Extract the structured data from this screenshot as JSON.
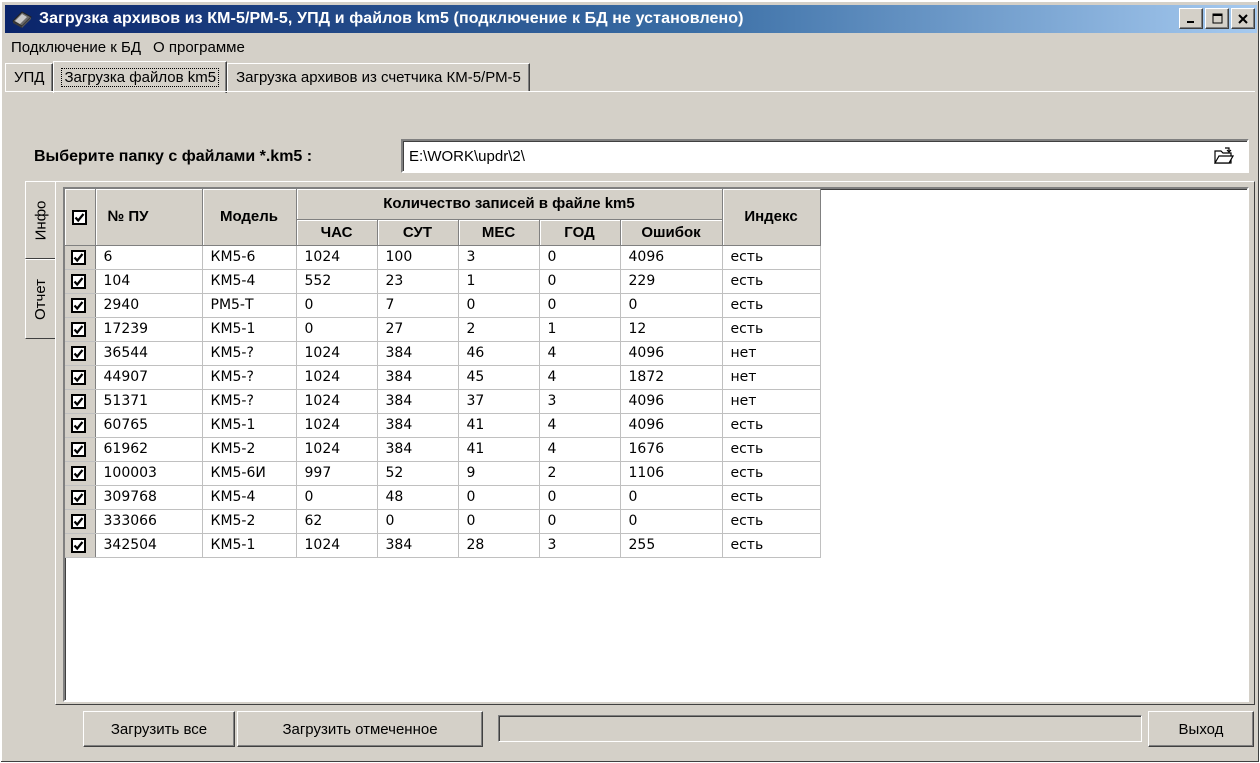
{
  "window": {
    "title": "Загрузка архивов из КМ-5/РМ-5, УПД и файлов km5 (подключение к БД не установлено)",
    "minimize": "_",
    "maximize": "□",
    "close": "×"
  },
  "menu": [
    "Подключение к БД",
    "О программе"
  ],
  "tabs": [
    "УПД",
    "Загрузка файлов km5",
    "Загрузка архивов из счетчика КМ-5/РМ-5"
  ],
  "active_tab": 1,
  "folder": {
    "label": "Выберите папку с файлами *.km5 :",
    "value": "E:\\WORK\\updr\\2\\"
  },
  "side_tabs": [
    "Инфо",
    "Отчет"
  ],
  "grid": {
    "header": {
      "pu": "№ ПУ",
      "model": "Модель",
      "group": "Количество записей в файле km5",
      "hour": "ЧАС",
      "day": "СУТ",
      "month": "МЕС",
      "year": "ГОД",
      "errors": "Ошибок",
      "index": "Индекс"
    },
    "header_checked": true,
    "rows": [
      {
        "checked": true,
        "pu": "6",
        "model": "КМ5-6",
        "hour": "1024",
        "day": "100",
        "month": "3",
        "year": "0",
        "errors": "4096",
        "index": "есть"
      },
      {
        "checked": true,
        "pu": "104",
        "model": "КМ5-4",
        "hour": "552",
        "day": "23",
        "month": "1",
        "year": "0",
        "errors": "229",
        "index": "есть"
      },
      {
        "checked": true,
        "pu": "2940",
        "model": "РМ5-Т",
        "hour": "0",
        "day": "7",
        "month": "0",
        "year": "0",
        "errors": "0",
        "index": "есть"
      },
      {
        "checked": true,
        "pu": "17239",
        "model": "КМ5-1",
        "hour": "0",
        "day": "27",
        "month": "2",
        "year": "1",
        "errors": "12",
        "index": "есть"
      },
      {
        "checked": true,
        "pu": "36544",
        "model": "КМ5-?",
        "hour": "1024",
        "day": "384",
        "month": "46",
        "year": "4",
        "errors": "4096",
        "index": "нет"
      },
      {
        "checked": true,
        "pu": "44907",
        "model": "КМ5-?",
        "hour": "1024",
        "day": "384",
        "month": "45",
        "year": "4",
        "errors": "1872",
        "index": "нет"
      },
      {
        "checked": true,
        "pu": "51371",
        "model": "КМ5-?",
        "hour": "1024",
        "day": "384",
        "month": "37",
        "year": "3",
        "errors": "4096",
        "index": "нет"
      },
      {
        "checked": true,
        "pu": "60765",
        "model": "КМ5-1",
        "hour": "1024",
        "day": "384",
        "month": "41",
        "year": "4",
        "errors": "4096",
        "index": "есть"
      },
      {
        "checked": true,
        "pu": "61962",
        "model": "КМ5-2",
        "hour": "1024",
        "day": "384",
        "month": "41",
        "year": "4",
        "errors": "1676",
        "index": "есть"
      },
      {
        "checked": true,
        "pu": "100003",
        "model": "КМ5-6И",
        "hour": "997",
        "day": "52",
        "month": "9",
        "year": "2",
        "errors": "1106",
        "index": "есть"
      },
      {
        "checked": true,
        "pu": "309768",
        "model": "КМ5-4",
        "hour": "0",
        "day": "48",
        "month": "0",
        "year": "0",
        "errors": "0",
        "index": "есть"
      },
      {
        "checked": true,
        "pu": "333066",
        "model": "КМ5-2",
        "hour": "62",
        "day": "0",
        "month": "0",
        "year": "0",
        "errors": "0",
        "index": "есть"
      },
      {
        "checked": true,
        "pu": "342504",
        "model": "КМ5-1",
        "hour": "1024",
        "day": "384",
        "month": "28",
        "year": "3",
        "errors": "255",
        "index": "есть"
      }
    ]
  },
  "buttons": {
    "load_all": "Загрузить все",
    "load_checked": "Загрузить отмеченное",
    "exit": "Выход"
  },
  "progress": 0,
  "icons": {
    "app": "eraser-icon",
    "folder_open": "folder-open-icon"
  }
}
